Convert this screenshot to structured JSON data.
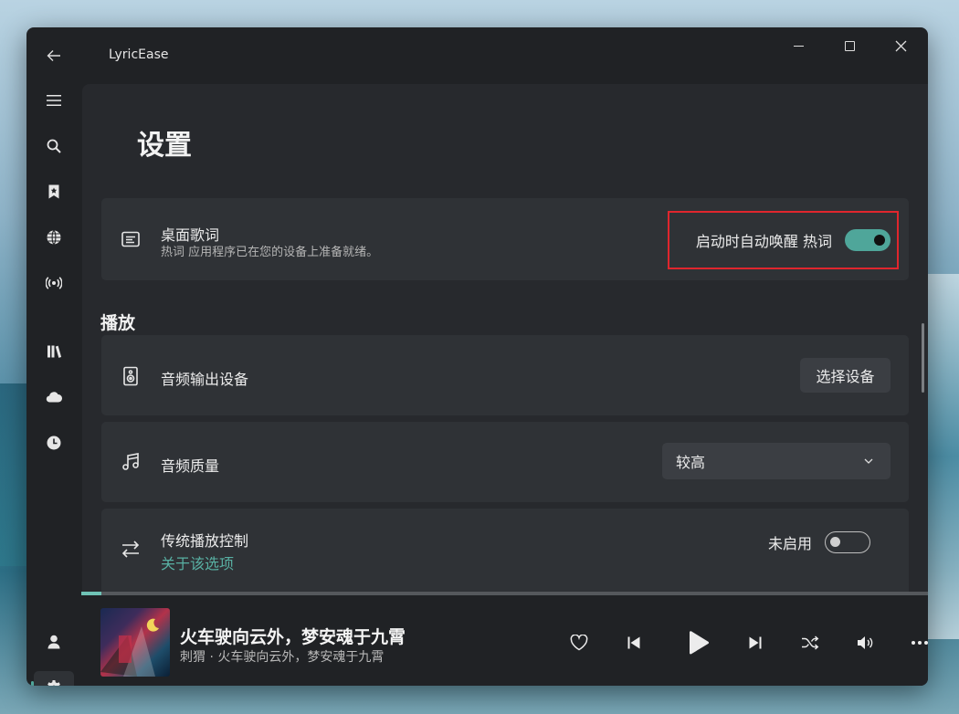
{
  "window": {
    "title": "LyricEase"
  },
  "page": {
    "title": "设置"
  },
  "desktop_lyrics": {
    "title": "桌面歌词",
    "subtitle": "热词 应用程序已在您的设备上准备就绪。",
    "toggle_label": "启动时自动唤醒 热词",
    "toggle_on": true
  },
  "playback": {
    "section_title": "播放",
    "output_device": {
      "title": "音频输出设备",
      "button": "选择设备"
    },
    "quality": {
      "title": "音频质量",
      "selected": "较高"
    },
    "legacy_control": {
      "title": "传统播放控制",
      "link": "关于该选项",
      "toggle_label": "未启用",
      "toggle_on": false
    }
  },
  "player": {
    "song_title": "火车驶向云外，梦安魂于九霄",
    "song_subtitle": "刺猬 · 火车驶向云外，梦安魂于九霄",
    "progress": 0.0
  },
  "sidebar": {
    "items": [
      "menu-icon",
      "search-icon",
      "bookmark-icon",
      "globe-icon",
      "radio-icon",
      "library-icon",
      "cloud-icon",
      "clock-icon",
      "user-icon",
      "settings-icon"
    ],
    "active": "settings-icon"
  },
  "colors": {
    "accent": "#4fa69a",
    "highlight": "#e0262d",
    "background": "#202225",
    "card": "#2f3236"
  }
}
